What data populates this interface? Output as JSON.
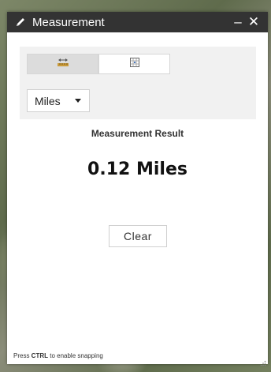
{
  "window": {
    "title": "Measurement",
    "title_icon": "pencil-icon",
    "minimize_label": "–",
    "close_label": "✕"
  },
  "tools": {
    "tabs": [
      {
        "name": "distance",
        "icon": "ruler-distance-icon",
        "active": true
      },
      {
        "name": "location",
        "icon": "location-grid-icon",
        "active": false
      }
    ]
  },
  "unit_select": {
    "selected": "Miles"
  },
  "result": {
    "label": "Measurement Result",
    "value": "0.12 Miles"
  },
  "actions": {
    "clear_label": "Clear"
  },
  "hint": {
    "prefix": "Press ",
    "key": "CTRL",
    "suffix": " to enable snapping"
  },
  "colors": {
    "titlebar": "#333333",
    "panel": "#f1f1f1",
    "active_tab": "#dcdcdc",
    "ruler_accent": "#c99a3a"
  }
}
